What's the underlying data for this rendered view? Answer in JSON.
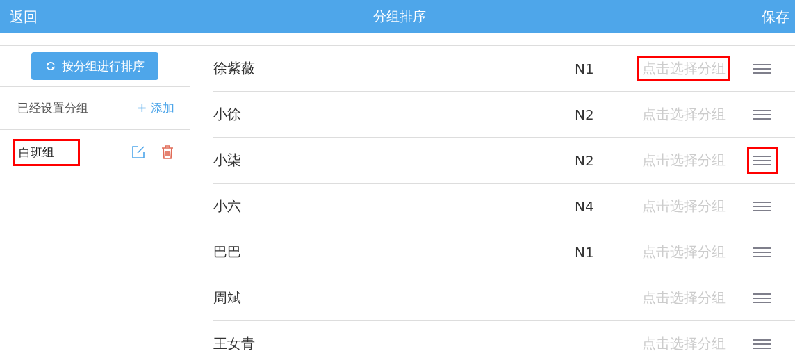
{
  "header": {
    "back": "返回",
    "title": "分组排序",
    "save": "保存"
  },
  "sidebar": {
    "sort_button": "按分组进行排序",
    "groups_label": "已经设置分组",
    "add": "+ 添加",
    "groups": [
      {
        "name": "白班组",
        "highlighted": true
      }
    ]
  },
  "rows": [
    {
      "name": "徐紫薇",
      "level": "N1",
      "group_placeholder": "点击选择分组",
      "group_highlighted": true,
      "handle_highlighted": false
    },
    {
      "name": "小徐",
      "level": "N2",
      "group_placeholder": "点击选择分组",
      "group_highlighted": false,
      "handle_highlighted": false
    },
    {
      "name": "小柒",
      "level": "N2",
      "group_placeholder": "点击选择分组",
      "group_highlighted": false,
      "handle_highlighted": true
    },
    {
      "name": "小六",
      "level": "N4",
      "group_placeholder": "点击选择分组",
      "group_highlighted": false,
      "handle_highlighted": false
    },
    {
      "name": "巴巴",
      "level": "N1",
      "group_placeholder": "点击选择分组",
      "group_highlighted": false,
      "handle_highlighted": false
    },
    {
      "name": "周斌",
      "group_placeholder": "点击选择分组",
      "group_highlighted": false,
      "handle_highlighted": false
    },
    {
      "name": "王女青",
      "group_placeholder": "点击选择分组",
      "group_highlighted": false,
      "handle_highlighted": false
    }
  ]
}
